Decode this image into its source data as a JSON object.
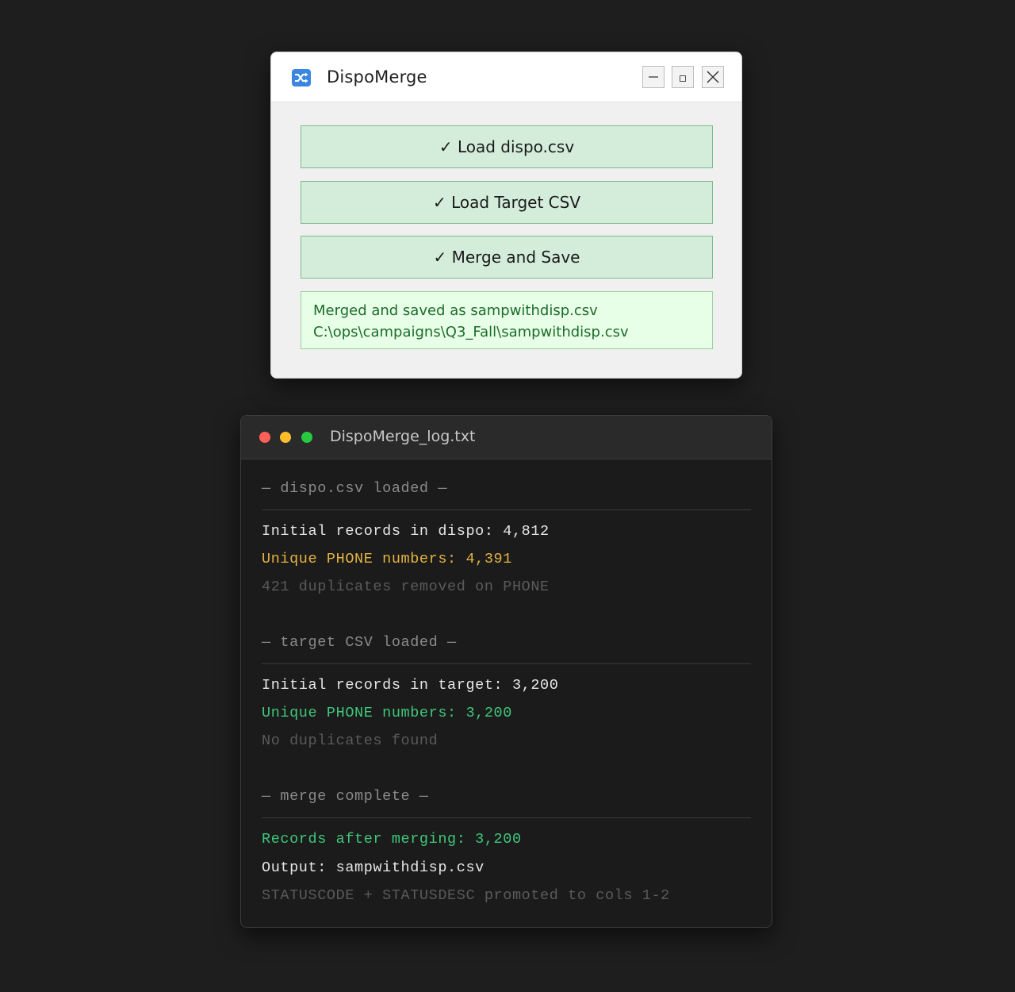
{
  "app": {
    "title": "DispoMerge",
    "icon": "shuffle-icon",
    "buttons": {
      "load_dispo": "✓ Load dispo.csv",
      "load_target": "✓ Load Target CSV",
      "merge_save": "✓ Merge and Save"
    },
    "status": {
      "line1": "Merged and saved as sampwithdisp.csv",
      "line2": "C:\\ops\\campaigns\\Q3_Fall\\sampwithdisp.csv"
    },
    "colors": {
      "button_bg": "#d4edda",
      "status_bg": "#e6ffe6",
      "status_text": "#1e6b2c"
    }
  },
  "log": {
    "title": "DispoMerge_log.txt",
    "sections": [
      {
        "header": "— dispo.csv loaded —",
        "lines": [
          {
            "text": "Initial records in dispo: 4,812",
            "tone": "white"
          },
          {
            "text": "Unique PHONE numbers: 4,391",
            "tone": "yellow"
          },
          {
            "text": "421 duplicates removed on PHONE",
            "tone": "dim"
          }
        ]
      },
      {
        "header": "— target CSV loaded —",
        "lines": [
          {
            "text": "Initial records in target: 3,200",
            "tone": "white"
          },
          {
            "text": "Unique PHONE numbers: 3,200",
            "tone": "green"
          },
          {
            "text": "No duplicates found",
            "tone": "dim"
          }
        ]
      },
      {
        "header": "— merge complete —",
        "lines": [
          {
            "text": "Records after merging: 3,200",
            "tone": "green"
          },
          {
            "text": "Output: sampwithdisp.csv",
            "tone": "white"
          },
          {
            "text": "STATUSCODE + STATUSDESC promoted to cols 1-2",
            "tone": "dim"
          }
        ]
      }
    ],
    "colors": {
      "white": "#e6e6e6",
      "yellow": "#e3b341",
      "green": "#3fc77a",
      "dim": "#5a5a5a",
      "header": "#8a8a8a"
    }
  }
}
